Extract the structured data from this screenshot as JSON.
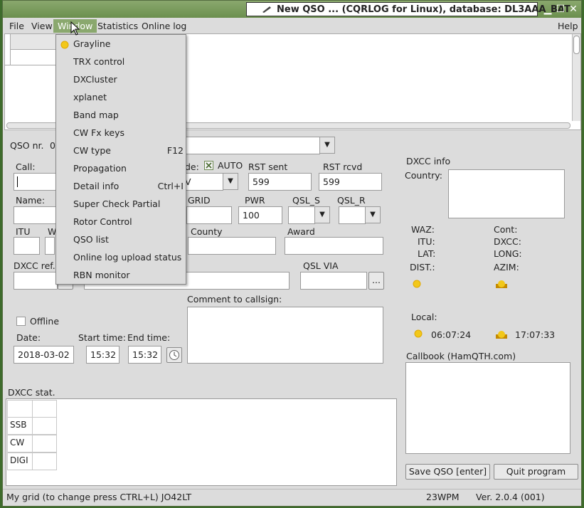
{
  "title": "New QSO ... (CQRLOG for Linux), database: DL3AAA_BAT",
  "menubar": {
    "file": "File",
    "view": "View",
    "window": "Window",
    "statistics": "Statistics",
    "online_log": "Online log",
    "help": "Help"
  },
  "window_menu": {
    "items": [
      {
        "label": "Grayline",
        "shortcut": ""
      },
      {
        "label": "TRX control",
        "shortcut": ""
      },
      {
        "label": "DXCluster",
        "shortcut": ""
      },
      {
        "label": "xplanet",
        "shortcut": ""
      },
      {
        "label": "Band map",
        "shortcut": ""
      },
      {
        "label": "CW Fx keys",
        "shortcut": ""
      },
      {
        "label": "CW type",
        "shortcut": "F12"
      },
      {
        "label": "Propagation",
        "shortcut": ""
      },
      {
        "label": "Detail info",
        "shortcut": "Ctrl+I"
      },
      {
        "label": "Super Check Partial",
        "shortcut": ""
      },
      {
        "label": "Rotor Control",
        "shortcut": ""
      },
      {
        "label": "QSO list",
        "shortcut": ""
      },
      {
        "label": "Online log upload status",
        "shortcut": ""
      },
      {
        "label": "RBN monitor",
        "shortcut": ""
      }
    ]
  },
  "form": {
    "qso_nr_label": "QSO nr.",
    "qso_nr_value": "0",
    "call_label": "Call:",
    "mode_label_fragment": "de:",
    "auto_label": "AUTO",
    "mode_value_fragment": "V",
    "rst_sent_label": "RST sent",
    "rst_sent_value": "599",
    "rst_rcvd_label": "RST rcvd",
    "rst_rcvd_value": "599",
    "name_label": "Name:",
    "grid_label": "GRID",
    "pwr_label": "PWR",
    "pwr_value": "100",
    "qsl_s_label": "QSL_S",
    "qsl_r_label": "QSL_R",
    "itu_label": "ITU",
    "waz_label_fragment": "W",
    "county_label": "County",
    "award_label": "Award",
    "dxcc_ref_label": "DXCC ref.",
    "qsl_via_label": "QSL VIA",
    "ellipsis": "...",
    "comment_label": "Comment to callsign:",
    "offline_label": "Offline",
    "date_label": "Date:",
    "date_value": "2018-03-02",
    "start_label": "Start time:",
    "start_value": "15:32",
    "end_label": "End time:",
    "end_value": "15:32"
  },
  "dxcc_info": {
    "title": "DXCC info",
    "country_label": "Country:",
    "waz": "WAZ:",
    "cont": "Cont:",
    "itu": "ITU:",
    "dxcc": "DXCC:",
    "lat": "LAT:",
    "long": "LONG:",
    "dist": "DIST.:",
    "azim": "AZIM:",
    "local_label": "Local:",
    "sunrise": "06:07:24",
    "sunset": "17:07:33"
  },
  "callbook_label": "Callbook (HamQTH.com)",
  "dxcc_stat": {
    "title": "DXCC stat.",
    "rows": [
      "SSB",
      "CW",
      "DIGI"
    ]
  },
  "buttons": {
    "save": "Save QSO [enter]",
    "quit": "Quit program"
  },
  "status": {
    "grid": "My grid (to change press CTRL+L) JO42LT",
    "wpm": "23WPM",
    "version": "Ver. 2.0.4 (001)"
  },
  "colors": {
    "accent": "#8aa86e",
    "desktop": "#3e6b2c",
    "sun": "#f2c81a"
  }
}
